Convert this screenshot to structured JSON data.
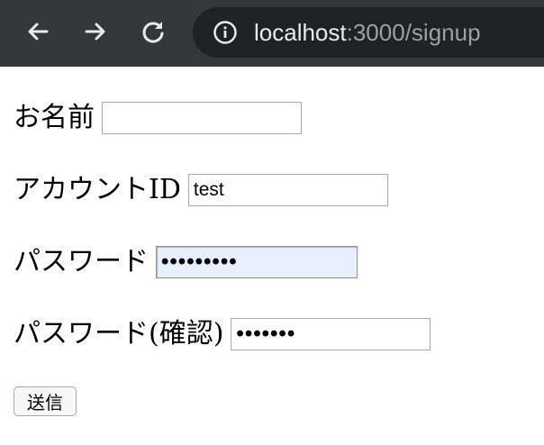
{
  "browser": {
    "url_host": "localhost",
    "url_path": ":3000/signup",
    "icons": {
      "back": "arrow-left-icon",
      "forward": "arrow-right-icon",
      "reload": "reload-icon",
      "site_info": "info-icon"
    },
    "colors": {
      "toolbar": "#35363a",
      "omnibox": "#202124",
      "host_text": "#e8eaed",
      "path_text": "#9aa0a6"
    }
  },
  "form": {
    "name": {
      "label": "お名前",
      "value": ""
    },
    "account_id": {
      "label": "アカウントID",
      "value": "test"
    },
    "password": {
      "label": "パスワード",
      "value": "•••••••••"
    },
    "password_confirm": {
      "label": "パスワード(確認)",
      "value": "•••••••"
    },
    "submit_label": "送信",
    "colors": {
      "autofill_bg": "#e8f0fe"
    }
  }
}
